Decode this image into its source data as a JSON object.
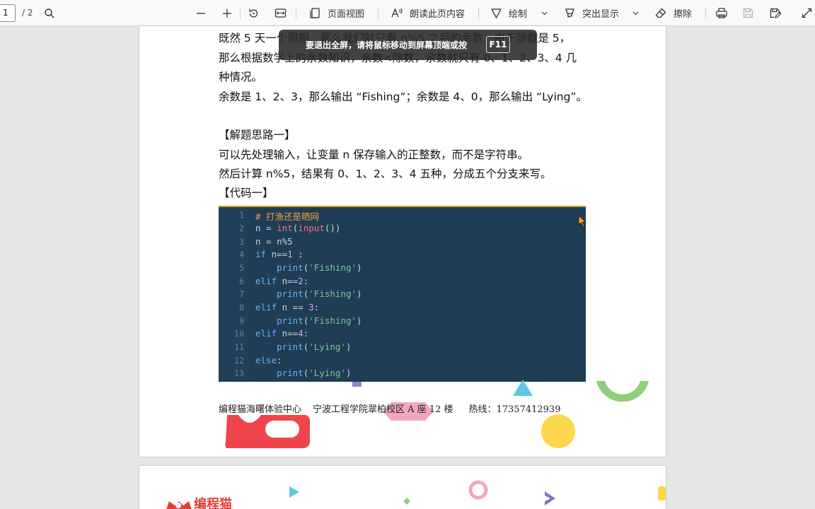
{
  "toolbar": {
    "page_current": "1",
    "page_total": "/ 2",
    "page_view_label": "页面视图",
    "read_aloud_label": "朗读此页内容",
    "draw_label": "绘制",
    "highlight_label": "突出显示",
    "erase_label": "擦除"
  },
  "toast": {
    "text": "要退出全屏，请将鼠标移动到屏幕顶端或按",
    "key": "F11"
  },
  "document": {
    "lines": [
      "既然 5 天一个周期，那么我们就只看 n%5 之后的余数，由于除数是 5，",
      "那么根据数学上的余数知识，余数<除数，余数就只有 0、1、2、3、4 几",
      "种情况。",
      "余数是 1、2、3，那么输出 “Fishing”；余数是 4、0，那么输出 “Lying”。",
      "【解题思路一】",
      "可以先处理输入，让变量 n 保存输入的正整数，而不是字符串。",
      "然后计算  n%5，结果有 0、1、2、3、4 五种，分成五个分支来写。",
      "【代码一】"
    ],
    "code_line_numbers": [
      "1",
      "2",
      "3",
      "4",
      "5",
      "6",
      "7",
      "8",
      "9",
      "10",
      "11",
      "12",
      "13"
    ],
    "code": {
      "l1_comment": "# 打渔还是晒网",
      "l2_a": "n = ",
      "l2_int": "int",
      "l2_p1": "(",
      "l2_input": "input",
      "l2_p2": "())",
      "l3": "n = n%5",
      "l4_kw": "if",
      "l4_a": " n==",
      "l4_n": "1",
      "l4_b": " :",
      "l5_a": "    ",
      "l5_fn": "print",
      "l5_p1": "(",
      "l5_s": "'Fishing'",
      "l5_p2": ")",
      "l6_kw": "elif",
      "l6_a": " n==",
      "l6_n": "2",
      "l6_b": ":",
      "l7_a": "    ",
      "l7_fn": "print",
      "l7_p1": "(",
      "l7_s": "'Fishing'",
      "l7_p2": ")",
      "l8_kw": "elif",
      "l8_a": " n == ",
      "l8_n": "3",
      "l8_b": ":",
      "l9_a": "    ",
      "l9_fn": "print",
      "l9_p1": "(",
      "l9_s": "'Fishing'",
      "l9_p2": ")",
      "l10_kw": "elif",
      "l10_a": " n==",
      "l10_n": "4",
      "l10_b": ":",
      "l11_a": "    ",
      "l11_fn": "print",
      "l11_p1": "(",
      "l11_s": "'Lying'",
      "l11_p2": ")",
      "l12_kw": "else",
      "l12_b": ":",
      "l13_a": "    ",
      "l13_fn": "print",
      "l13_p1": "(",
      "l13_s": "'Lying'",
      "l13_p2": ")"
    },
    "footer": {
      "center": "编程猫海曙体验中心",
      "address": "宁波工程学院翠柏校区 A 座 12 楼",
      "hotline": "热线：17357412939"
    },
    "logo_text": "编程猫"
  },
  "colors": {
    "code_bg": "#1f3d55",
    "code_keyword": "#6ab0f3",
    "code_function": "#f07178",
    "code_string": "#7ec699",
    "code_comment": "#e8a14a",
    "brand_red": "#f0444d"
  }
}
